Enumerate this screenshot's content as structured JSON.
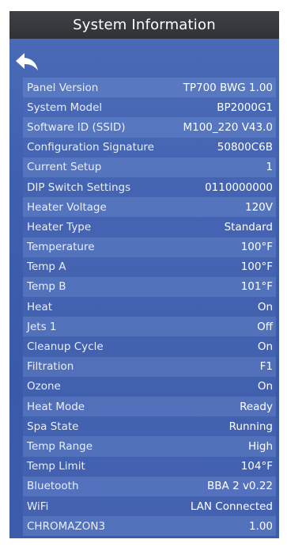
{
  "header": {
    "title": "System Information"
  },
  "back_icon": "back-arrow-icon",
  "rows": [
    {
      "label": "Panel Version",
      "value": "TP700 BWG 1.00"
    },
    {
      "label": "System Model",
      "value": "BP2000G1"
    },
    {
      "label": "Software ID (SSID)",
      "value": "M100_220 V43.0"
    },
    {
      "label": "Configuration Signature",
      "value": "50800C6B"
    },
    {
      "label": "Current Setup",
      "value": "1"
    },
    {
      "label": "DIP Switch Settings",
      "value": "0110000000"
    },
    {
      "label": "Heater Voltage",
      "value": "120V"
    },
    {
      "label": "Heater Type",
      "value": "Standard"
    },
    {
      "label": "Temperature",
      "value": "100°F"
    },
    {
      "label": "Temp A",
      "value": "100°F"
    },
    {
      "label": "Temp B",
      "value": "101°F"
    },
    {
      "label": "Heat",
      "value": "On"
    },
    {
      "label": "Jets 1",
      "value": "Off"
    },
    {
      "label": "Cleanup Cycle",
      "value": "On"
    },
    {
      "label": "Filtration",
      "value": "F1"
    },
    {
      "label": "Ozone",
      "value": "On"
    },
    {
      "label": "Heat Mode",
      "value": "Ready"
    },
    {
      "label": "Spa State",
      "value": "Running"
    },
    {
      "label": "Temp Range",
      "value": "High"
    },
    {
      "label": "Temp Limit",
      "value": "104°F"
    },
    {
      "label": "Bluetooth",
      "value": "BBA 2 v0.22"
    },
    {
      "label": "WiFi",
      "value": "LAN Connected"
    },
    {
      "label": "CHROMAZON3",
      "value": "1.00"
    }
  ],
  "colors": {
    "panel_background": "#3f5ea8",
    "title_bar": "#34363a",
    "text": "#ffffff"
  }
}
